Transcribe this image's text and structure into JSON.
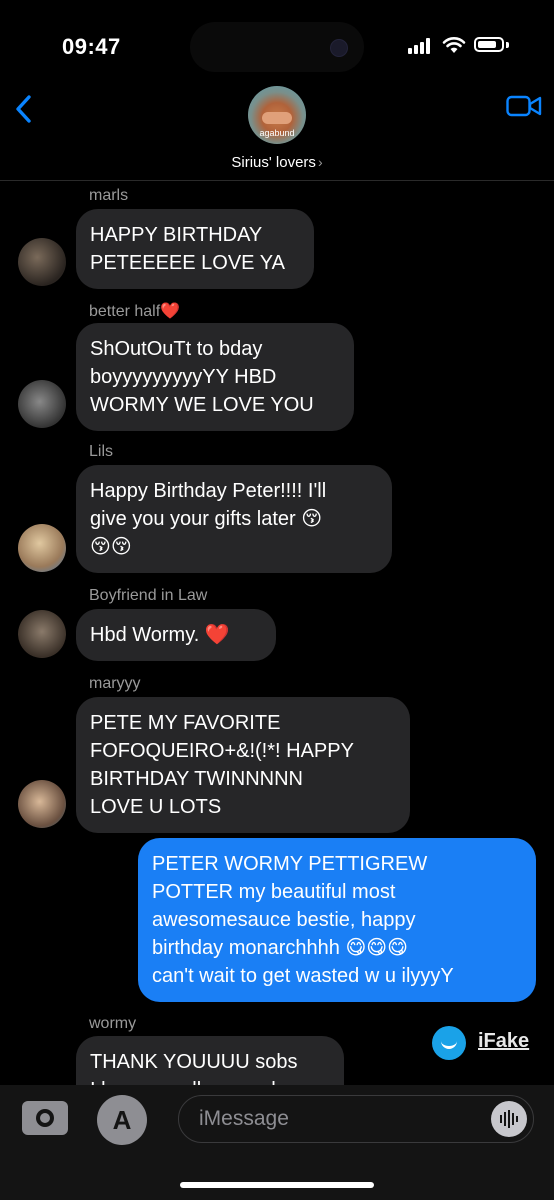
{
  "status": {
    "time": "09:47"
  },
  "header": {
    "group_name": "Sirius' lovers",
    "avatar_text": "agabund",
    "chevron": "›"
  },
  "icons": {
    "back": "chevron-left-icon",
    "video": "video-camera-icon",
    "camera": "camera-icon",
    "apps": "app-store-icon",
    "audio": "waveform-icon"
  },
  "colors": {
    "outgoing": "#1a7ff5",
    "incoming": "#262628",
    "accent": "#0a84ff"
  },
  "messages": [
    {
      "sender": "marls",
      "text": "HAPPY BIRTHDAY\nPETEEEEE LOVE YA"
    },
    {
      "sender": "better half❤️",
      "text": "ShOutOuTt to bday\nboyyyyyyyyyYY HBD\nWORMY WE LOVE YOU"
    },
    {
      "sender": "Lils",
      "text": "Happy Birthday Peter!!!! I'll\ngive you your gifts later 😚\n😚😚"
    },
    {
      "sender": "Boyfriend in Law",
      "text": "Hbd Wormy. ❤️"
    },
    {
      "sender": "maryyy",
      "text": "PETE MY FAVORITE\nFOFOQUEIRO+&!(!*! HAPPY\nBIRTHDAY TWINNNNN\nLOVE U LOTS"
    },
    {
      "sender": "",
      "text": "PETER WORMY PETTIGREW\nPOTTER my beautiful most\nawesomesauce bestie, happy\nbirthday monarchhhh 😋😋😋\ncan't wait to get wasted w u ilyyyY"
    },
    {
      "sender": "wormy",
      "text": "THANK YOUUUU sobs\nI love you all so much"
    }
  ],
  "watermark": {
    "label": "iFake"
  },
  "input": {
    "placeholder": "iMessage"
  }
}
